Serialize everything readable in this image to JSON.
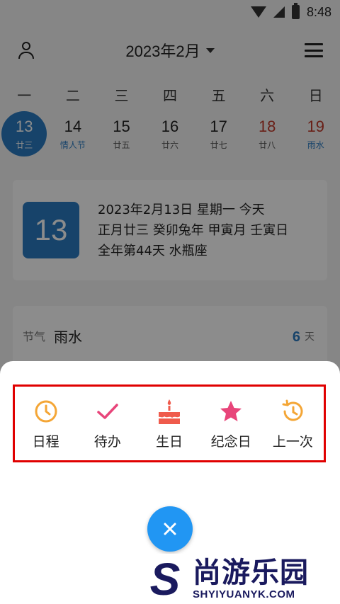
{
  "status_bar": {
    "time": "8:48"
  },
  "header": {
    "title": "2023年2月"
  },
  "weekdays": [
    "一",
    "二",
    "三",
    "四",
    "五",
    "六",
    "日"
  ],
  "days": [
    {
      "num": "13",
      "sub": "廿三"
    },
    {
      "num": "14",
      "sub": "情人节"
    },
    {
      "num": "15",
      "sub": "廿五"
    },
    {
      "num": "16",
      "sub": "廿六"
    },
    {
      "num": "17",
      "sub": "廿七"
    },
    {
      "num": "18",
      "sub": "廿八"
    },
    {
      "num": "19",
      "sub": "雨水"
    }
  ],
  "date_card": {
    "big_day": "13",
    "line1": "2023年2月13日 星期一 今天",
    "line2": "正月廿三 癸卯兔年 甲寅月 壬寅日",
    "line3": "全年第44天 水瓶座"
  },
  "solar_term": {
    "label": "节气",
    "name": "雨水",
    "count": "6",
    "unit": "天"
  },
  "actions": [
    {
      "label": "日程",
      "icon": "clock-icon",
      "color": "#f4a636"
    },
    {
      "label": "待办",
      "icon": "check-icon",
      "color": "#e8457a"
    },
    {
      "label": "生日",
      "icon": "cake-icon",
      "color": "#ef5b4c"
    },
    {
      "label": "纪念日",
      "icon": "star-icon",
      "color": "#e8457a"
    },
    {
      "label": "上一次",
      "icon": "history-icon",
      "color": "#f4a636"
    }
  ],
  "watermark": {
    "letter": "S",
    "cn": "尚游乐园",
    "en": "SHYIYUANYK.COM"
  },
  "colors": {
    "accent": "#2a7bc1",
    "fab": "#2196f3",
    "highlight_box": "#e00000"
  }
}
